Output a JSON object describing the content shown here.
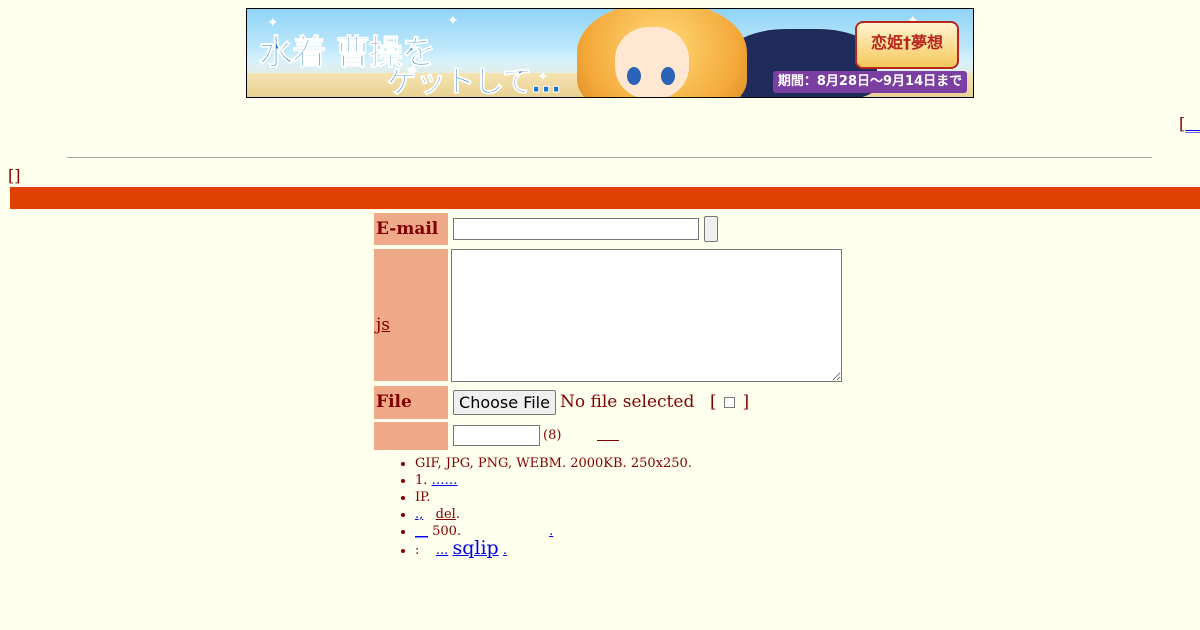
{
  "banner": {
    "headline_1": "水着 曹操を",
    "headline_2": "ゲットして…",
    "logo_text": "恋姫†夢想",
    "period": "期間：8月28日〜9月14日まで"
  },
  "top_right": {
    "bracket": "[",
    "link": "__"
  },
  "thread_brackets": "[]",
  "form": {
    "email_label": "E-mail",
    "email_value": "",
    "comment_label": "js",
    "comment_value": "",
    "file_label": "File",
    "file_button": "Choose File",
    "file_status": "No file selected",
    "nofile_open": "[",
    "nofile_close": "]",
    "password_hint": "(8)"
  },
  "rules": [
    {
      "text": "GIF, JPG, PNG, WEBM. 2000KB. 250x250."
    },
    {
      "text": "1.",
      "link": "……"
    },
    {
      "text": "IP."
    },
    {
      "prefix_link": ".,",
      "link": "del",
      "suffix": "."
    },
    {
      "prefix_link": "__",
      "text": "500.",
      "trailing_link": "."
    },
    {
      "text": ":",
      "link_small": "...",
      "link": "sqlip",
      "suffix": "."
    }
  ]
}
